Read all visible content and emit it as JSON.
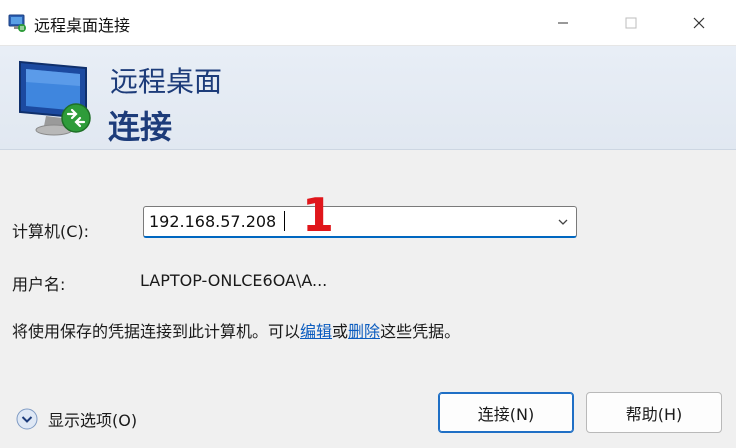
{
  "window": {
    "title": "远程桌面连接",
    "controls": [
      "minimize-icon",
      "maximize-icon",
      "close-icon"
    ]
  },
  "banner": {
    "line1": "远程桌面",
    "line2": "连接"
  },
  "form": {
    "computer_label": "计算机(C):",
    "computer_value": "192.168.57.208",
    "annotation": "1",
    "user_label": "用户名:",
    "user_value": "LAPTOP-ONLCE6OA\\A..."
  },
  "info": {
    "prefix": "将使用保存的凭据连接到此计算机。可以",
    "edit_link": "编辑",
    "middle": "或",
    "delete_link": "删除",
    "suffix": "这些凭据。"
  },
  "footer": {
    "options_label": "显示选项(O)",
    "connect_button": "连接(N)",
    "help_button": "帮助(H)"
  },
  "colors": {
    "accent": "#0067c0",
    "banner_text": "#1d3c7a",
    "annotation": "#e0161b",
    "link": "#0b5cbf"
  }
}
